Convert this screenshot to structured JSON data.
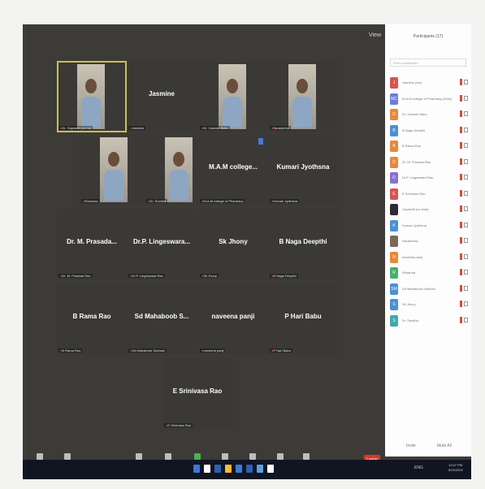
{
  "window": {
    "view_label": "View"
  },
  "tiles": [
    {
      "display_name": "",
      "tag": "Dr. Gopisetti (co-ho)",
      "video": true,
      "active": true
    },
    {
      "display_name": "Jasmine",
      "tag": "Jasmine",
      "video": false
    },
    {
      "display_name": "",
      "tag": "Dr. Ganesh Babu",
      "video": true
    },
    {
      "display_name": "",
      "tag": "Narasimha",
      "video": true
    },
    {
      "display_name": "",
      "tag": "Rosanna",
      "video": true
    },
    {
      "display_name": "",
      "tag": "Dr. Sunitha",
      "video": true
    },
    {
      "display_name": "M.A.M college...",
      "tag": "M.A.M college of Pharmacy",
      "video": false
    },
    {
      "display_name": "Kumari Jyothsna",
      "tag": "Kumari Jyothsna",
      "video": false
    },
    {
      "display_name": "Dr. M. Prasada...",
      "tag": "Dr. M. Prasada Rao",
      "video": false
    },
    {
      "display_name": "Dr.P. Lingeswara...",
      "tag": "Dr.P. Lingeswara Rao",
      "video": false
    },
    {
      "display_name": "Sk Jhony",
      "tag": "Sk Jhony",
      "video": false
    },
    {
      "display_name": "B Naga Deepthi",
      "tag": "B Naga Deepthi",
      "video": false
    },
    {
      "display_name": "B Rama Rao",
      "tag": "B Rama Rao",
      "video": false
    },
    {
      "display_name": "Sd Mahaboob S...",
      "tag": "Sd Mahaboob Subhani",
      "video": false
    },
    {
      "display_name": "naveena panji",
      "tag": "naveena panji",
      "video": false
    },
    {
      "display_name": "P Hari Babu",
      "tag": "P Hari Babu",
      "video": false
    },
    {
      "display_name": "E Srinivasa Rao",
      "tag": "E Srinivasa Rao",
      "video": false
    }
  ],
  "toolbar": {
    "buttons": [
      "Mute",
      "Start Video",
      "Participants",
      "Chat",
      "Share Screen",
      "Record",
      "Live Transcript",
      "Reactions",
      "Apps"
    ],
    "leave_label": "Leave"
  },
  "participants_panel": {
    "title": "Participants (17)",
    "search_placeholder": "Find a participant",
    "invite_label": "Invite",
    "mute_all_label": "Mute All",
    "items": [
      {
        "initial": "J",
        "name": "Jasmine (me)",
        "color": "#d9534f"
      },
      {
        "initial": "MC",
        "name": "M.A.M college of Pharmacy (Host)",
        "color": "#6b7fd7"
      },
      {
        "initial": "D",
        "name": "Dr. Ganesh Babu",
        "color": "#e8883a"
      },
      {
        "initial": "B",
        "name": "B Naga Deepthi",
        "color": "#4d8fd4"
      },
      {
        "initial": "B",
        "name": "B Rama Rao",
        "color": "#e8883a"
      },
      {
        "initial": "D",
        "name": "Dr. M. Prasada Rao",
        "color": "#e8883a"
      },
      {
        "initial": "D",
        "name": "Dr.P. Lingeswara Rao",
        "color": "#8a6fd1"
      },
      {
        "initial": "E",
        "name": "E Srinivasa Rao",
        "color": "#d9534f"
      },
      {
        "initial": "",
        "name": "Gopisetti (co-host)",
        "color": "#2f2a36"
      },
      {
        "initial": "K",
        "name": "Kumari Jyothsna",
        "color": "#4d8fd4"
      },
      {
        "initial": "",
        "name": "Narasimha",
        "color": "#7a6a5a"
      },
      {
        "initial": "N",
        "name": "naveena panji",
        "color": "#e8883a"
      },
      {
        "initial": "R",
        "name": "Rosanna",
        "color": "#45b06a"
      },
      {
        "initial": "SM",
        "name": "Sd Mahaboob Subhani",
        "color": "#4d8fd4"
      },
      {
        "initial": "S",
        "name": "Sk Jhony",
        "color": "#4d8fd4"
      },
      {
        "initial": "S",
        "name": "Dr. Sunitha",
        "color": "#45a6b0"
      }
    ]
  },
  "taskbar": {
    "clock_time": "12:07 PM",
    "clock_date": "5/22/2022",
    "tray_text": "ENG"
  }
}
